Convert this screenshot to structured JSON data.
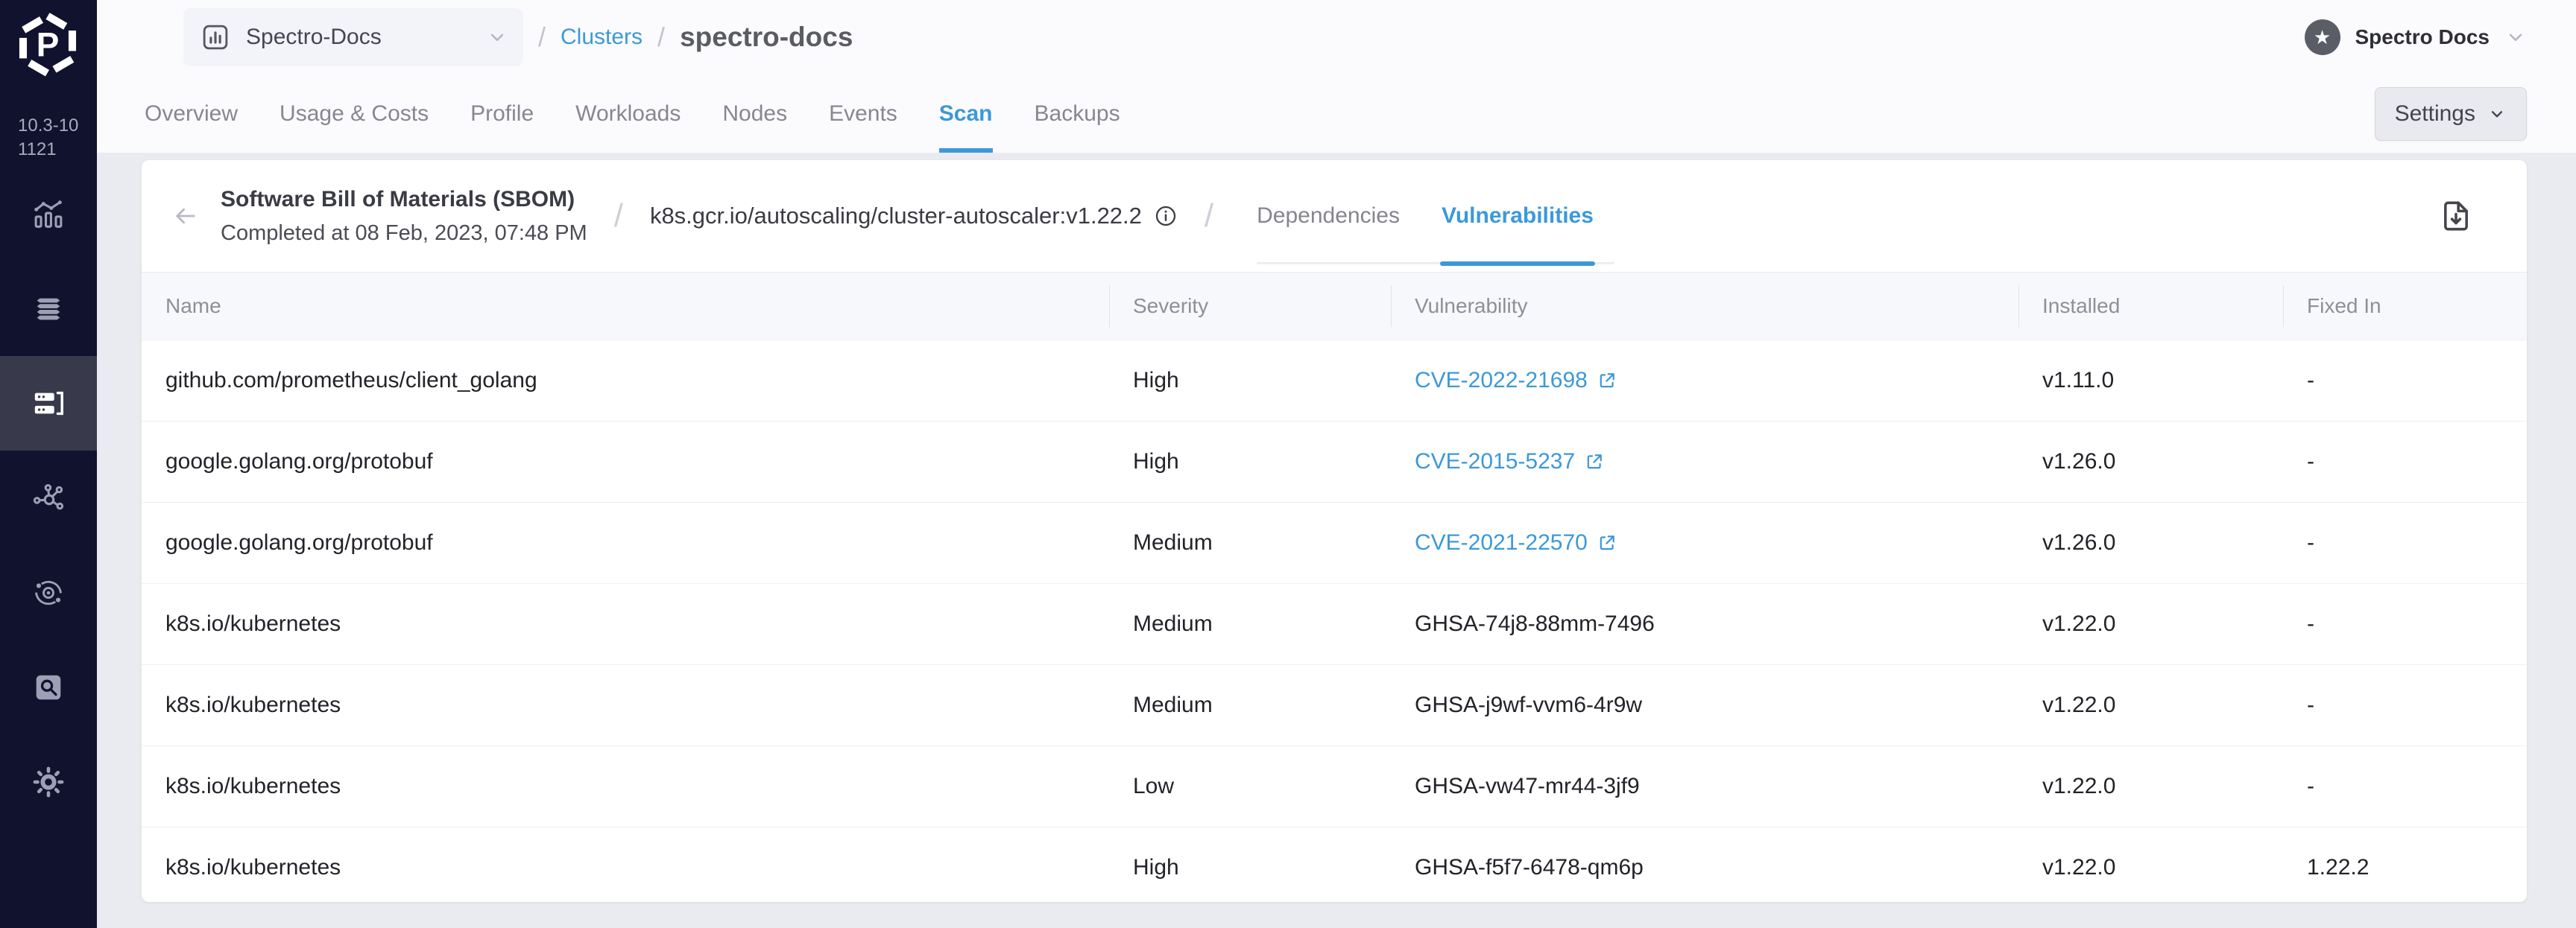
{
  "app": {
    "version": "10.3-101121",
    "logo_icon": "palette-hexagon-p-logo"
  },
  "sidebar": {
    "items": [
      {
        "icon": "analytics-chart-icon",
        "active": false
      },
      {
        "icon": "layers-stack-icon",
        "active": false
      },
      {
        "icon": "clusters-servers-icon",
        "active": true
      },
      {
        "icon": "network-nodes-icon",
        "active": false
      },
      {
        "icon": "orbit-rings-icon",
        "active": false
      },
      {
        "icon": "scan-box-icon",
        "active": false
      },
      {
        "icon": "gear-icon",
        "active": false
      }
    ]
  },
  "topbar": {
    "project_selector": {
      "value": "Spectro-Docs",
      "icon": "bar-chart-icon",
      "chevron": "chevron-down-icon"
    },
    "breadcrumb": {
      "separator": "/",
      "link": "Clusters",
      "current": "spectro-docs"
    },
    "user_menu": {
      "label": "Spectro Docs",
      "avatar_icon": "star-icon",
      "chevron": "chevron-down-icon"
    },
    "settings_button": {
      "label": "Settings",
      "chevron": "chevron-down-icon"
    }
  },
  "cluster_tabs": {
    "items": [
      {
        "label": "Overview",
        "active": false
      },
      {
        "label": "Usage & Costs",
        "active": false
      },
      {
        "label": "Profile",
        "active": false
      },
      {
        "label": "Workloads",
        "active": false
      },
      {
        "label": "Nodes",
        "active": false
      },
      {
        "label": "Events",
        "active": false
      },
      {
        "label": "Scan",
        "active": true
      },
      {
        "label": "Backups",
        "active": false
      }
    ]
  },
  "sbom_panel": {
    "title": "Software Bill of Materials (SBOM)",
    "subtitle": "Completed at 08 Feb, 2023, 07:48 PM",
    "separator": "/",
    "image_ref": "k8s.gcr.io/autoscaling/cluster-autoscaler:v1.22.2",
    "info_icon": "info-circle-icon",
    "download_icon": "download-file-icon",
    "back_icon": "arrow-left-icon",
    "tabs": [
      {
        "label": "Dependencies",
        "active": false
      },
      {
        "label": "Vulnerabilities",
        "active": true
      }
    ]
  },
  "vulnerability_table": {
    "columns": [
      "Name",
      "Severity",
      "Vulnerability",
      "Installed",
      "Fixed In"
    ],
    "rows": [
      {
        "name": "github.com/prometheus/client_golang",
        "severity": "High",
        "vulnerability": "CVE-2022-21698",
        "vulnerability_is_link": true,
        "installed": "v1.11.0",
        "fixed_in": "-"
      },
      {
        "name": "google.golang.org/protobuf",
        "severity": "High",
        "vulnerability": "CVE-2015-5237",
        "vulnerability_is_link": true,
        "installed": "v1.26.0",
        "fixed_in": "-"
      },
      {
        "name": "google.golang.org/protobuf",
        "severity": "Medium",
        "vulnerability": "CVE-2021-22570",
        "vulnerability_is_link": true,
        "installed": "v1.26.0",
        "fixed_in": "-"
      },
      {
        "name": "k8s.io/kubernetes",
        "severity": "Medium",
        "vulnerability": "GHSA-74j8-88mm-7496",
        "vulnerability_is_link": false,
        "installed": "v1.22.0",
        "fixed_in": "-"
      },
      {
        "name": "k8s.io/kubernetes",
        "severity": "Medium",
        "vulnerability": "GHSA-j9wf-vvm6-4r9w",
        "vulnerability_is_link": false,
        "installed": "v1.22.0",
        "fixed_in": "-"
      },
      {
        "name": "k8s.io/kubernetes",
        "severity": "Low",
        "vulnerability": "GHSA-vw47-mr44-3jf9",
        "vulnerability_is_link": false,
        "installed": "v1.22.0",
        "fixed_in": "-"
      },
      {
        "name": "k8s.io/kubernetes",
        "severity": "High",
        "vulnerability": "GHSA-f5f7-6478-qm6p",
        "vulnerability_is_link": false,
        "installed": "v1.22.0",
        "fixed_in": "1.22.2"
      }
    ]
  },
  "colors": {
    "accent_blue": "#3b99d9",
    "sidebar_bg": "#10122e",
    "sidebar_active_bg": "#383a4c",
    "page_bg": "#eaebf1",
    "topbar_bg": "#fbfbfd",
    "card_bg": "#ffffff",
    "table_header_bg": "#f7f8fb",
    "muted_text": "#8e8f99",
    "dark_text": "#26272d"
  }
}
